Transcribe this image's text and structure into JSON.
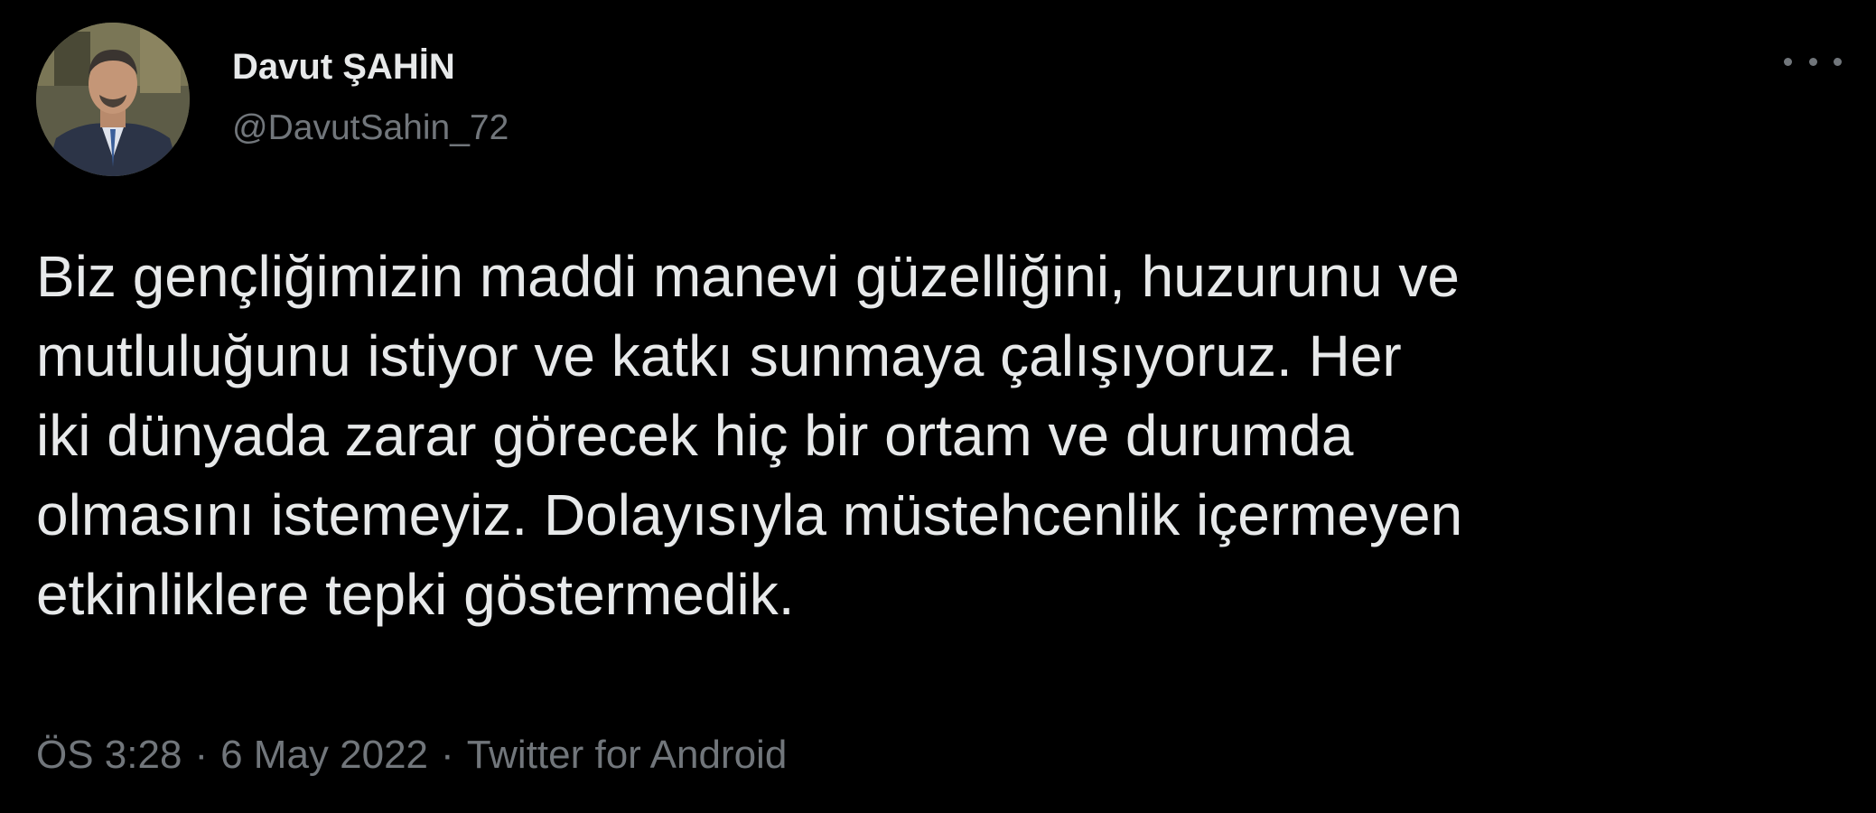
{
  "author": {
    "display_name": "Davut ŞAHİN",
    "handle": "@DavutSahin_72"
  },
  "menu": {
    "icon": "more-horizontal-icon"
  },
  "tweet": {
    "lines": [
      "Biz gençliğimizin maddi manevi güzelliğini, huzurunu ve",
      "mutluluğunu istiyor ve katkı sunmaya çalışıyoruz. Her",
      "iki dünyada zarar görecek hiç bir ortam ve durumda",
      "olmasını istemeyiz. Dolayısıyla müstehcenlik içermeyen",
      "etkinliklere tepki göstermedik."
    ]
  },
  "meta": {
    "time": "ÖS 3:28",
    "separator": "·",
    "date": "6 May 2022",
    "source": "Twitter for Android"
  },
  "colors": {
    "background": "#000000",
    "primary_text": "#e7e9ea",
    "secondary_text": "#71767b"
  }
}
